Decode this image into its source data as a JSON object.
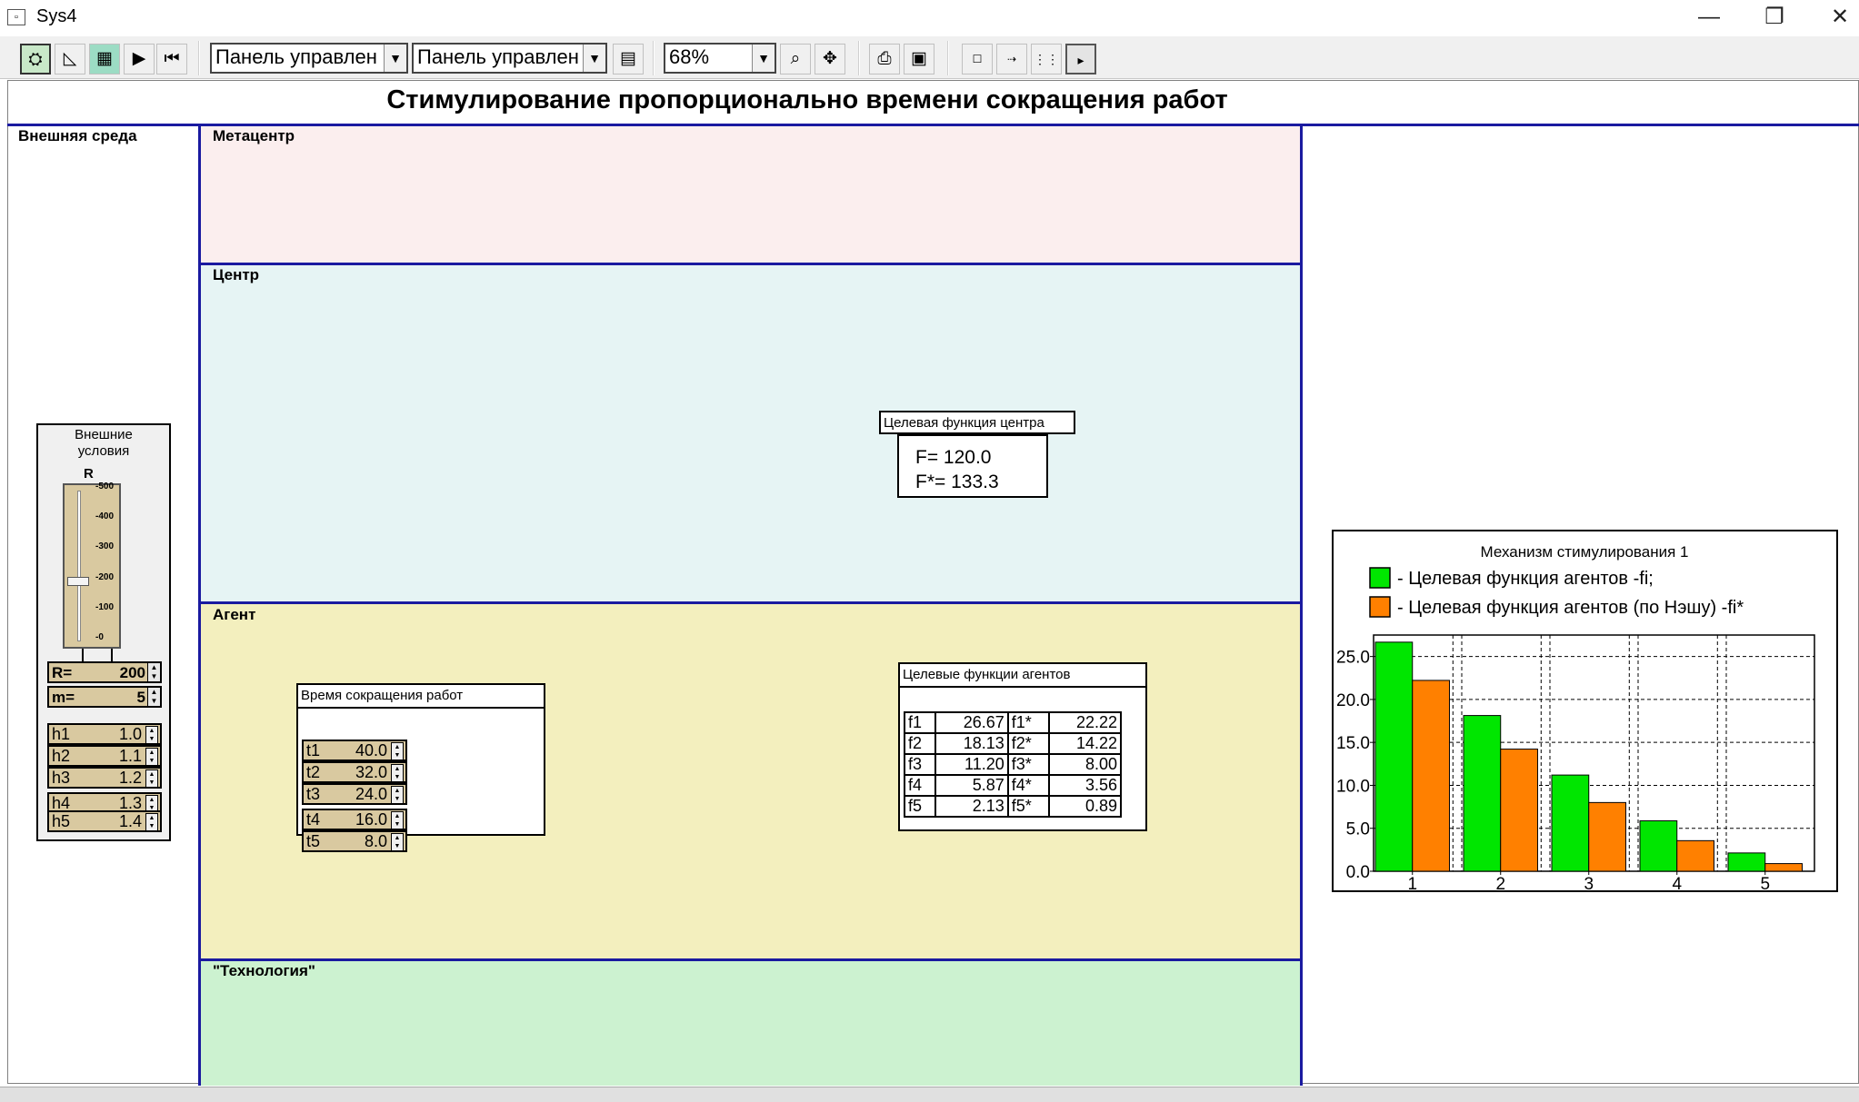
{
  "window": {
    "title": "Sys4",
    "minimize": "—",
    "restore": "❐",
    "close": "✕"
  },
  "toolbar": {
    "panel_combo_1": "Панель управлен",
    "panel_combo_2": "Панель управлен",
    "zoom": "68%"
  },
  "page": {
    "title": "Стимулирование пропорционально времени сокращения работ"
  },
  "zones": {
    "external": "Внешняя среда",
    "metacenter": "Метацентр",
    "center": "Центр",
    "agent": "Агент",
    "technology": "\"Технология\""
  },
  "env": {
    "title_line1": "Внешние",
    "title_line2": "условия",
    "slider_label": "R",
    "slider_ticks": [
      "500",
      "400",
      "300",
      "200",
      "100",
      "0"
    ],
    "slider_value": 200,
    "slider_max": 500,
    "R": {
      "label": "R=",
      "value": "200"
    },
    "m": {
      "label": "m=",
      "value": "5"
    },
    "h": [
      {
        "label": "h1",
        "value": "1.0"
      },
      {
        "label": "h2",
        "value": "1.1"
      },
      {
        "label": "h3",
        "value": "1.2"
      },
      {
        "label": "h4",
        "value": "1.3"
      },
      {
        "label": "h5",
        "value": "1.4"
      }
    ]
  },
  "center_fn": {
    "title": "Целевая функция центра",
    "F": "F=  120.0",
    "Fstar": "F*= 133.3"
  },
  "reduction": {
    "title": "Время сокращения работ",
    "rows": [
      {
        "label": "t1",
        "value": "40.0"
      },
      {
        "label": "t2",
        "value": "32.0"
      },
      {
        "label": "t3",
        "value": "24.0"
      },
      {
        "label": "t4",
        "value": "16.0"
      },
      {
        "label": "t5",
        "value": "8.0"
      }
    ]
  },
  "agents_fn": {
    "title": "Целевые функции агентов",
    "rows": [
      {
        "f": "f1",
        "fv": "26.67",
        "fs": "f1*",
        "fsv": "22.22"
      },
      {
        "f": "f2",
        "fv": "18.13",
        "fs": "f2*",
        "fsv": "14.22"
      },
      {
        "f": "f3",
        "fv": "11.20",
        "fs": "f3*",
        "fsv": "8.00"
      },
      {
        "f": "f4",
        "fv": "5.87",
        "fs": "f4*",
        "fsv": "3.56"
      },
      {
        "f": "f5",
        "fv": "2.13",
        "fs": "f5*",
        "fsv": "0.89"
      }
    ]
  },
  "chart_data": {
    "type": "bar",
    "title": "Механизм стимулирования 1",
    "categories": [
      "1",
      "2",
      "3",
      "4",
      "5"
    ],
    "series": [
      {
        "name": "- Целевая функция агентов -fi;",
        "color": "#00e600",
        "values": [
          26.67,
          18.13,
          11.2,
          5.87,
          2.13
        ]
      },
      {
        "name": "- Целевая функция агентов (по Нэшу) -fi*",
        "color": "#ff8000",
        "values": [
          22.22,
          14.22,
          8.0,
          3.56,
          0.89
        ]
      }
    ],
    "y_ticks": [
      "0.0",
      "5.0",
      "10.0",
      "15.0",
      "20.0",
      "25.0"
    ],
    "ylim": [
      0,
      27.5
    ],
    "grid": true,
    "legend": "top"
  }
}
